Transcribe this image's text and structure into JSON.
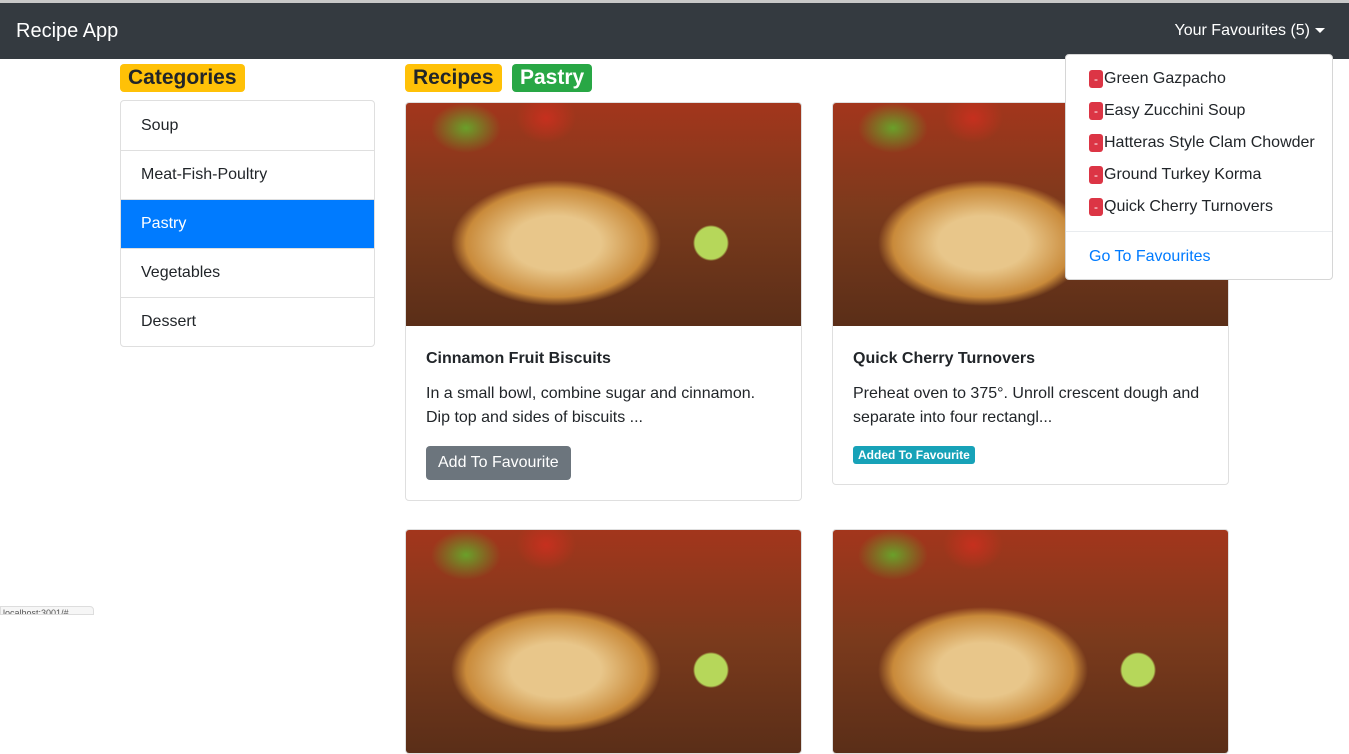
{
  "navbar": {
    "brand": "Recipe App",
    "favourites_toggle": "Your Favourites (5)"
  },
  "categories": {
    "heading": "Categories",
    "items": [
      "Soup",
      "Meat-Fish-Poultry",
      "Pastry",
      "Vegetables",
      "Dessert"
    ],
    "active": "Pastry"
  },
  "recipes": {
    "heading": "Recipes",
    "category_badge": "Pastry",
    "cards": [
      {
        "title": "Cinnamon Fruit Biscuits",
        "text": "In a small bowl, combine sugar and cinnamon. Dip top and sides of biscuits ...",
        "action": "Add To Favourite"
      },
      {
        "title": "Quick Cherry Turnovers",
        "text": "Preheat oven to 375°. Unroll crescent dough and separate into four rectangl...",
        "status": "Added To Favourite"
      }
    ]
  },
  "favourites_dropdown": {
    "remove_label": "-",
    "items": [
      "Green Gazpacho",
      "Easy Zucchini Soup",
      "Hatteras Style Clam Chowder",
      "Ground Turkey Korma",
      "Quick Cherry Turnovers"
    ],
    "link": "Go To Favourites"
  },
  "status_bar": "localhost:3001/#"
}
